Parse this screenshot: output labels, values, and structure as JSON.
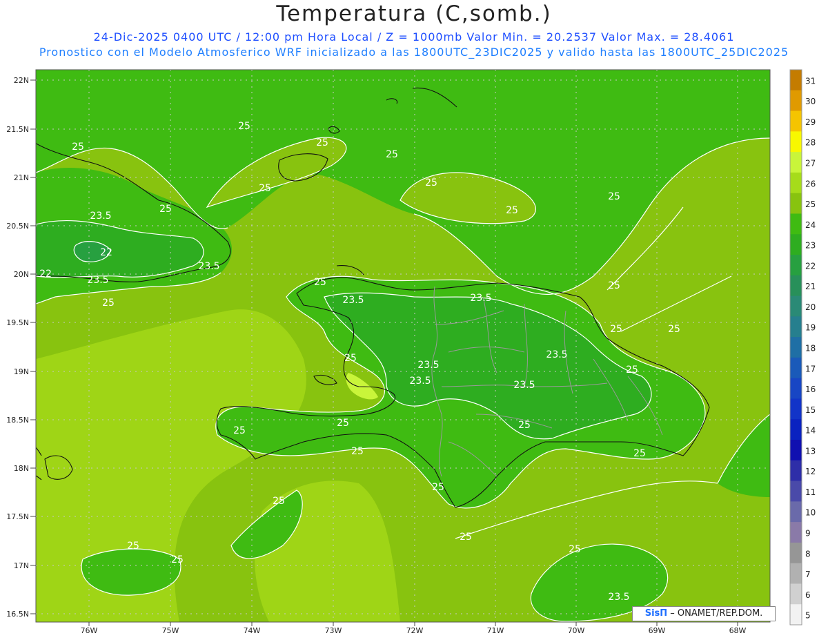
{
  "header": {
    "title": "Temperatura (C,somb.)",
    "subtitle_1": "24-Dic-2025 0400 UTC / 12:00 pm Hora Local / Z = 1000mb   Valor Min. = 20.2537   Valor Max. = 28.4061",
    "subtitle_2": "Pronostico con el Modelo Atmosferico WRF inicializado a las 1800UTC_23DIC2025 y valido hasta las  1800UTC_25DIC2025"
  },
  "axes": {
    "lat_labels": [
      "22N",
      "21.5N",
      "21N",
      "20.5N",
      "20N",
      "19.5N",
      "19N",
      "18.5N",
      "18N",
      "17.5N",
      "17N",
      "16.5N"
    ],
    "lon_labels": [
      "76W",
      "75W",
      "74W",
      "73W",
      "72W",
      "71W",
      "70W",
      "69W",
      "68W"
    ]
  },
  "colorbar": {
    "labels": [
      "31",
      "30",
      "29",
      "28",
      "27",
      "26",
      "25",
      "24",
      "23",
      "22",
      "21",
      "20",
      "19",
      "18",
      "17",
      "16",
      "15",
      "14",
      "13",
      "12",
      "11",
      "10",
      "9",
      "8",
      "7",
      "6",
      "5"
    ],
    "colors": [
      "#c47c00",
      "#e09a00",
      "#f5c400",
      "#f8f800",
      "#c9f53a",
      "#a6dc1a",
      "#88c30f",
      "#3fbb12",
      "#2ead20",
      "#27a040",
      "#28905a",
      "#2a8a76",
      "#267f8e",
      "#1f6fa5",
      "#1a5ab9",
      "#1846c4",
      "#1234c8",
      "#0a22c0",
      "#1010b0",
      "#2e2ea8",
      "#4a4aa9",
      "#6a6aaa",
      "#8a7aa8",
      "#969696",
      "#b1b1b1",
      "#d0d0d0",
      "#f2f2f2"
    ]
  },
  "contour_labels": [
    {
      "text": "25"
    },
    {
      "text": "25"
    },
    {
      "text": "25"
    },
    {
      "text": "25"
    },
    {
      "text": "25"
    },
    {
      "text": "25"
    },
    {
      "text": "25"
    },
    {
      "text": "25"
    },
    {
      "text": "25"
    },
    {
      "text": "25"
    },
    {
      "text": "25"
    },
    {
      "text": "25"
    },
    {
      "text": "25"
    },
    {
      "text": "25"
    },
    {
      "text": "25"
    },
    {
      "text": "25"
    },
    {
      "text": "25"
    },
    {
      "text": "25"
    },
    {
      "text": "25"
    },
    {
      "text": "25"
    },
    {
      "text": "25"
    },
    {
      "text": "25"
    },
    {
      "text": "25"
    },
    {
      "text": "25"
    },
    {
      "text": "25"
    },
    {
      "text": "25"
    },
    {
      "text": "25"
    },
    {
      "text": "23.5"
    },
    {
      "text": "23.5"
    },
    {
      "text": "23.5"
    },
    {
      "text": "23.5"
    },
    {
      "text": "23.5"
    },
    {
      "text": "23.5"
    },
    {
      "text": "23.5"
    },
    {
      "text": "23.5"
    },
    {
      "text": "23.5"
    },
    {
      "text": "23.5"
    },
    {
      "text": "22"
    },
    {
      "text": "22"
    }
  ],
  "credit": {
    "logo_text": "SisΠ",
    "text": " – ONAMET/REP.DOM."
  }
}
